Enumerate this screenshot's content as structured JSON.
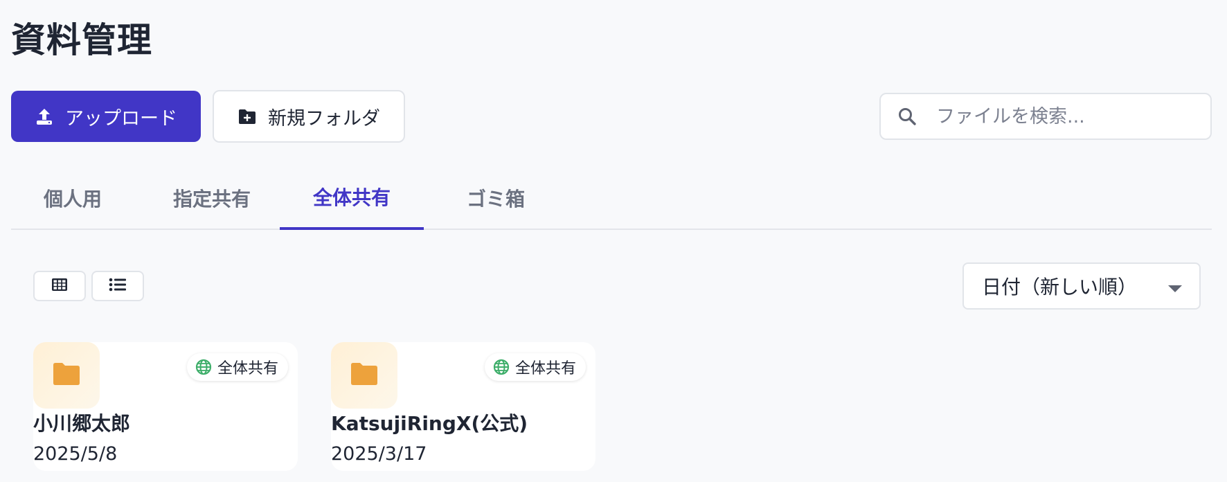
{
  "page": {
    "title": "資料管理"
  },
  "toolbar": {
    "upload_label": "アップロード",
    "new_folder_label": "新規フォルダ"
  },
  "search": {
    "placeholder": "ファイルを検索...",
    "value": ""
  },
  "tabs": [
    {
      "label": "個人用",
      "active": false
    },
    {
      "label": "指定共有",
      "active": false
    },
    {
      "label": "全体共有",
      "active": true
    },
    {
      "label": "ゴミ箱",
      "active": false
    }
  ],
  "view": {
    "modes": [
      "grid-icon",
      "list-icon"
    ]
  },
  "sort": {
    "selected": "日付（新しい順）",
    "icon": "caret-down-icon"
  },
  "items": [
    {
      "name": "小川郷太郎",
      "date": "2025/5/8",
      "badge": "全体共有",
      "type": "folder"
    },
    {
      "name": "KatsujiRingX(公式)",
      "date": "2025/3/17",
      "badge": "全体共有",
      "type": "folder"
    }
  ],
  "colors": {
    "accent": "#4136c6",
    "folder": "#eda23c",
    "globe": "#3eae6a",
    "text": "#1f2533",
    "muted": "#6b7180",
    "background": "#f8f9fb"
  }
}
